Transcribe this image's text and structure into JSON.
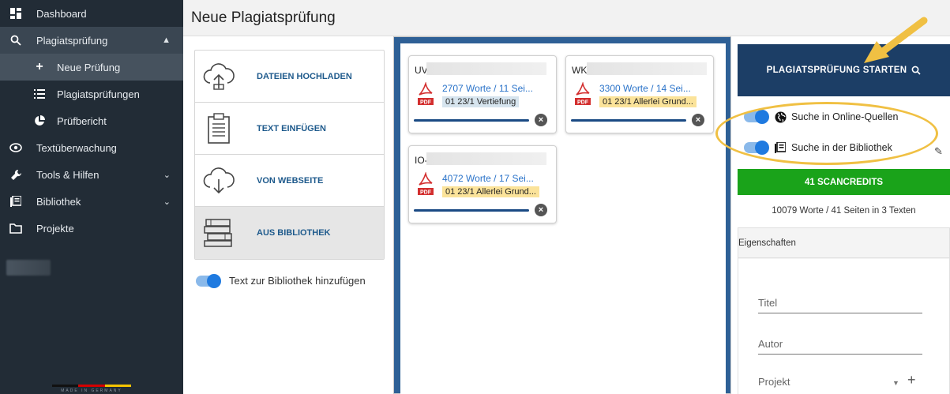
{
  "sidebar": {
    "items": [
      {
        "label": "Dashboard"
      },
      {
        "label": "Plagiatsprüfung"
      },
      {
        "label": "Neue Prüfung"
      },
      {
        "label": "Plagiatsprüfungen"
      },
      {
        "label": "Prüfbericht"
      },
      {
        "label": "Textüberwachung"
      },
      {
        "label": "Tools & Hilfen"
      },
      {
        "label": "Bibliothek"
      },
      {
        "label": "Projekte"
      }
    ],
    "footer": "MADE IN GERMANY"
  },
  "header": {
    "title": "Neue Plagiatsprüfung"
  },
  "upload_options": [
    {
      "label": "DATEIEN HOCHLADEN"
    },
    {
      "label": "TEXT EINFÜGEN"
    },
    {
      "label": "VON WEBSEITE"
    },
    {
      "label": "AUS BIBLIOTHEK"
    }
  ],
  "library_toggle": {
    "label": "Text zur Bibliothek hinzufügen",
    "on": true
  },
  "documents": [
    {
      "title": "UV-H",
      "words": "2707 Worte / 11 Sei...",
      "tag": "01 23/1 Vertiefung",
      "tag_color": "#d6e4ee"
    },
    {
      "title": "WK-H",
      "words": "3300 Worte / 14 Sei...",
      "tag": "01 23/1 Allerlei Grund...",
      "tag_color": "#fbe39a"
    },
    {
      "title": "IO-H",
      "words": "4072 Worte / 17 Sei...",
      "tag": "01 23/1 Allerlei Grund...",
      "tag_color": "#fbe39a"
    }
  ],
  "right": {
    "start_button": "PLAGIATSPRÜFUNG STARTEN",
    "option_online": "Suche in Online-Quellen",
    "option_library": "Suche in der Bibliothek",
    "credits": "41 SCANCREDITS",
    "summary": "10079 Worte / 41 Seiten in 3 Texten",
    "properties_title": "Eigenschaften",
    "field_title": "Titel",
    "field_author": "Autor",
    "field_project": "Projekt"
  },
  "colors": {
    "sidebar": "#222c36",
    "accent_blue": "#1c3e66",
    "credits_green": "#1aa31a",
    "annotation": "#f0c043"
  }
}
